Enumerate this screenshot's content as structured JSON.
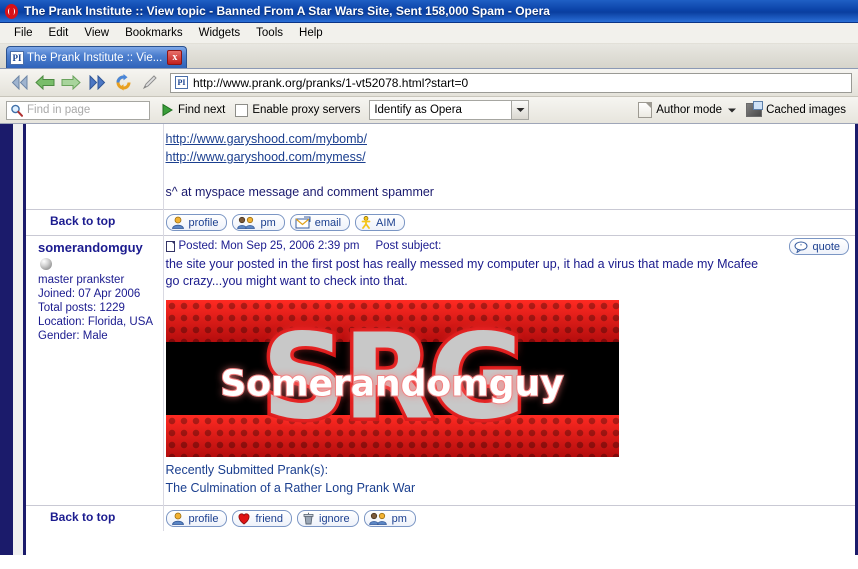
{
  "window": {
    "title": "The Prank Institute :: View topic - Banned From A Star Wars Site, Sent 158,000 Spam - Opera",
    "app_icon": "opera-icon"
  },
  "menubar": {
    "items": [
      {
        "label": "File"
      },
      {
        "label": "Edit"
      },
      {
        "label": "View"
      },
      {
        "label": "Bookmarks"
      },
      {
        "label": "Widgets"
      },
      {
        "label": "Tools"
      },
      {
        "label": "Help"
      }
    ]
  },
  "tabbar": {
    "tabs": [
      {
        "title": "The Prank Institute :: Vie...",
        "favicon_text": "PI",
        "close_label": "x",
        "active": true
      }
    ]
  },
  "navbar": {
    "buttons": [
      {
        "name": "rewind-button",
        "icon": "double-chevron-left-icon"
      },
      {
        "name": "back-button",
        "icon": "arrow-left-icon"
      },
      {
        "name": "forward-button",
        "icon": "arrow-right-icon"
      },
      {
        "name": "fast-forward-button",
        "icon": "double-chevron-right-icon"
      },
      {
        "name": "reload-button",
        "icon": "reload-icon"
      },
      {
        "name": "edit-button",
        "icon": "pencil-icon"
      }
    ],
    "url": "http://www.prank.org/pranks/1-vt52078.html?start=0",
    "url_favicon_text": "PI"
  },
  "findbar": {
    "search_placeholder": "Find in page",
    "search_value": "",
    "find_next_label": "Find next",
    "proxy_label": "Enable proxy servers",
    "proxy_checked": false,
    "identify_value": "Identify as Opera",
    "author_mode_label": "Author mode",
    "cached_images_label": "Cached images"
  },
  "page": {
    "post_top": {
      "links": [
        "http://www.garyshood.com/mybomb/",
        "http://www.garyshood.com/mymess/"
      ],
      "signature": "s^ at myspace message and comment spammer",
      "back_to_top": "Back to top",
      "buttons": [
        {
          "label": "profile",
          "icon": "profile-icon"
        },
        {
          "label": "pm",
          "icon": "pm-icon"
        },
        {
          "label": "email",
          "icon": "email-icon"
        },
        {
          "label": "AIM",
          "icon": "aim-icon"
        }
      ]
    },
    "post": {
      "username": "somerandomguy",
      "rank_title": "master prankster",
      "joined": "Joined: 07 Apr 2006",
      "total_posts": "Total posts: 1229",
      "location": "Location: Florida, USA",
      "gender": "Gender: Male",
      "posted": "Posted: Mon Sep 25, 2006 2:39 pm",
      "post_subject_label": "Post subject:",
      "quote_label": "quote",
      "body_line1": "the site your posted in the first post has really messed my computer up, it had a virus that made my Mcafee",
      "body_line2": "go crazy...you might want to check into that.",
      "sig_image": {
        "big_text": "SRG",
        "overlay_text": "Somerandomguy",
        "bg_color": "#000000",
        "stripe_color": "#ff2a22",
        "letter_color": "#c8c8c8",
        "letter_outline": "#d41515"
      },
      "sig_caption_line1": "Recently Submitted Prank(s):",
      "sig_caption_line2": "The Culmination of a Rather Long Prank War",
      "back_to_top": "Back to top",
      "buttons": [
        {
          "label": "profile",
          "icon": "profile-icon"
        },
        {
          "label": "friend",
          "icon": "heart-icon"
        },
        {
          "label": "ignore",
          "icon": "ignore-icon"
        },
        {
          "label": "pm",
          "icon": "pm-icon"
        }
      ]
    }
  },
  "colors": {
    "titlebar": "#0b43a8",
    "link": "#1b3f8f",
    "forum_border": "#1b1b6b",
    "text": "#1a1a8c"
  }
}
